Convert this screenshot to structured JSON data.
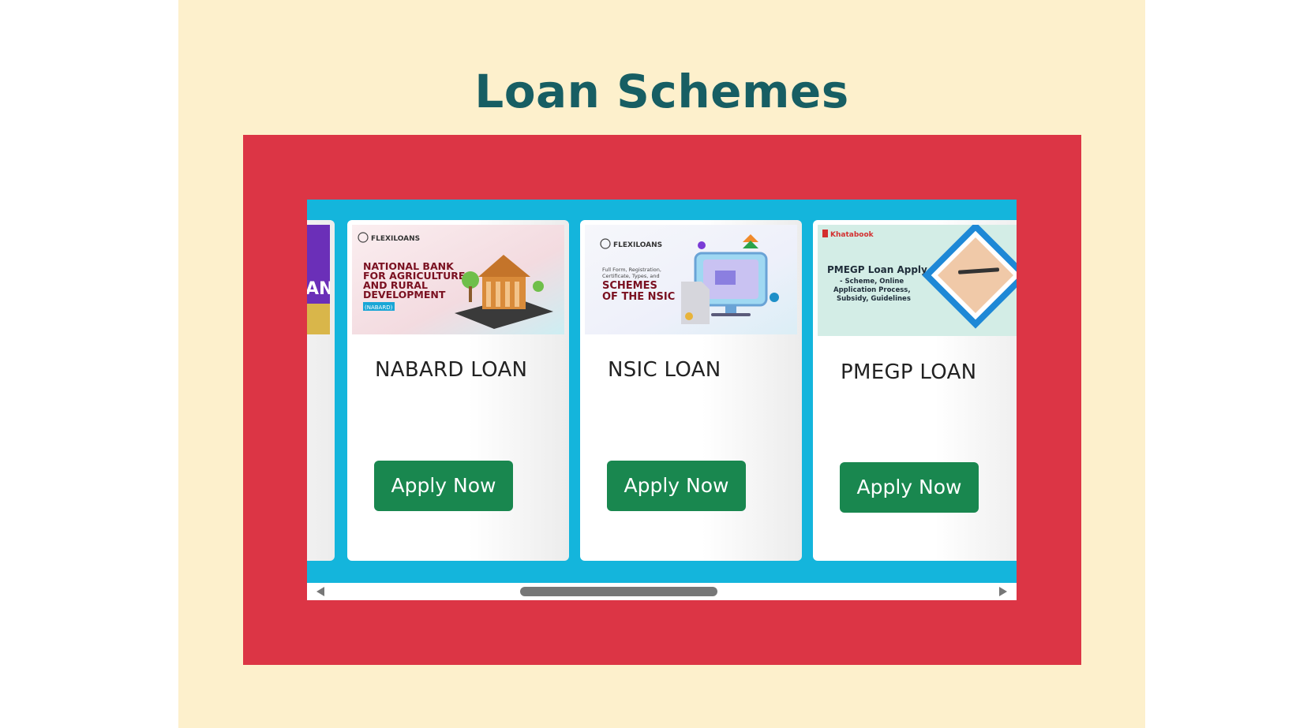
{
  "page": {
    "title": "Loan Schemes"
  },
  "colors": {
    "page_bg": "#fdf0cc",
    "title": "#175e63",
    "frame": "#dc3545",
    "scroller": "#14b5dc",
    "button": "#19874f"
  },
  "cards": [
    {
      "title": "NABARD LOAN",
      "button_label": "Apply Now",
      "image": {
        "brand": "FLEXILOANS",
        "headline": [
          "NATIONAL BANK",
          "FOR AGRICULTURE",
          "AND RURAL",
          "DEVELOPMENT"
        ],
        "tag": "(NABARD)",
        "icon": "bank-building-icon"
      }
    },
    {
      "title": "NSIC LOAN",
      "button_label": "Apply Now",
      "image": {
        "brand": "FLEXILOANS",
        "subline": [
          "Full Form, Registration,",
          "Certificate, Types, and"
        ],
        "headline": [
          "SCHEMES",
          "OF THE NSIC"
        ],
        "icon": "monitor-document-icon"
      }
    },
    {
      "title": "PMEGP LOAN",
      "button_label": "Apply Now",
      "image": {
        "brand": "Khatabook",
        "headline": "PMEGP Loan Apply",
        "subline": [
          "- Scheme, Online",
          "Application Process,",
          "Subsidy, Guidelines"
        ],
        "icon": "handshake-pen-icon"
      }
    }
  ],
  "partial_card": {
    "image_text": "AN"
  }
}
